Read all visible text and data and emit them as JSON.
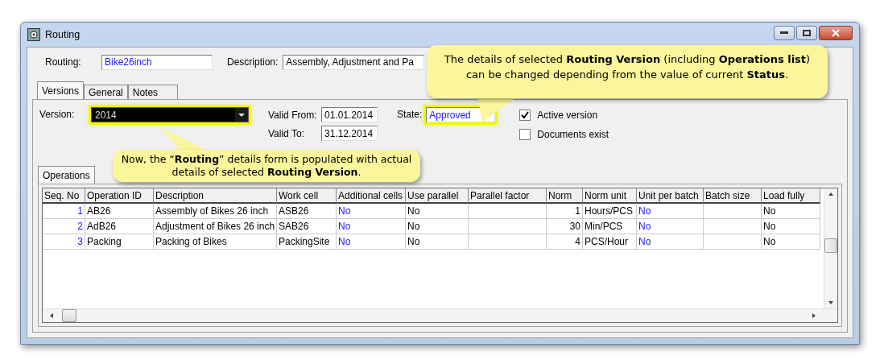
{
  "window": {
    "title": "Routing"
  },
  "routing": {
    "label": "Routing:",
    "value": "Bike26inch"
  },
  "description": {
    "label": "Description:",
    "value": "Assembly, Adjustment and Pa"
  },
  "tabs": [
    {
      "label": "Versions",
      "selected": true
    },
    {
      "label": "General",
      "selected": false
    },
    {
      "label": "Notes",
      "selected": false
    }
  ],
  "version": {
    "label": "Version:",
    "value": "2014",
    "highlighted": true
  },
  "valid_from": {
    "label": "Valid From:",
    "value": "01.01.2014"
  },
  "valid_to": {
    "label": "Valid To:",
    "value": "31.12.2014"
  },
  "state": {
    "label": "State:",
    "value": "Approved",
    "highlighted": true
  },
  "checkboxes": [
    {
      "label": "Active version",
      "checked": true
    },
    {
      "label": "Documents exist",
      "checked": false
    }
  ],
  "inner_tabs": [
    {
      "label": "Operations",
      "selected": true
    }
  ],
  "table": {
    "columns": [
      {
        "header": "Seq. No",
        "kind": "seq"
      },
      {
        "header": "Operation ID",
        "kind": "text"
      },
      {
        "header": "Description",
        "kind": "text"
      },
      {
        "header": "Work cell",
        "kind": "text"
      },
      {
        "header": "Additional cells",
        "kind": "flag"
      },
      {
        "header": "Use parallel",
        "kind": "text"
      },
      {
        "header": "Parallel factor",
        "kind": "text"
      },
      {
        "header": "Norm",
        "kind": "number"
      },
      {
        "header": "Norm unit",
        "kind": "text"
      },
      {
        "header": "Unit per batch",
        "kind": "flag"
      },
      {
        "header": "Batch size",
        "kind": "text"
      },
      {
        "header": "Load fully",
        "kind": "text"
      }
    ],
    "rows": [
      {
        "cells": [
          "1",
          "AB26",
          "Assembly of Bikes 26 inch",
          "ASB26",
          "No",
          "No",
          "",
          "1",
          "Hours/PCS",
          "No",
          "",
          "No"
        ]
      },
      {
        "cells": [
          "2",
          "AdB26",
          "Adjustment of Bikes 26 inch",
          "SAB26",
          "No",
          "No",
          "",
          "30",
          "Min/PCS",
          "No",
          "",
          "No"
        ]
      },
      {
        "cells": [
          "3",
          "Packing",
          "Packing of Bikes",
          "PackingSite",
          "No",
          "No",
          "",
          "4",
          "PCS/Hour",
          "No",
          "",
          "No"
        ]
      }
    ]
  },
  "callouts": [
    {
      "text": "The details of selected **Routing Version** (including **Operations list**) can be changed depending from the value of current **Status**."
    },
    {
      "text": "Now, the “**Routing**” details form is populated with actual details of selected **Routing Version**."
    }
  ]
}
